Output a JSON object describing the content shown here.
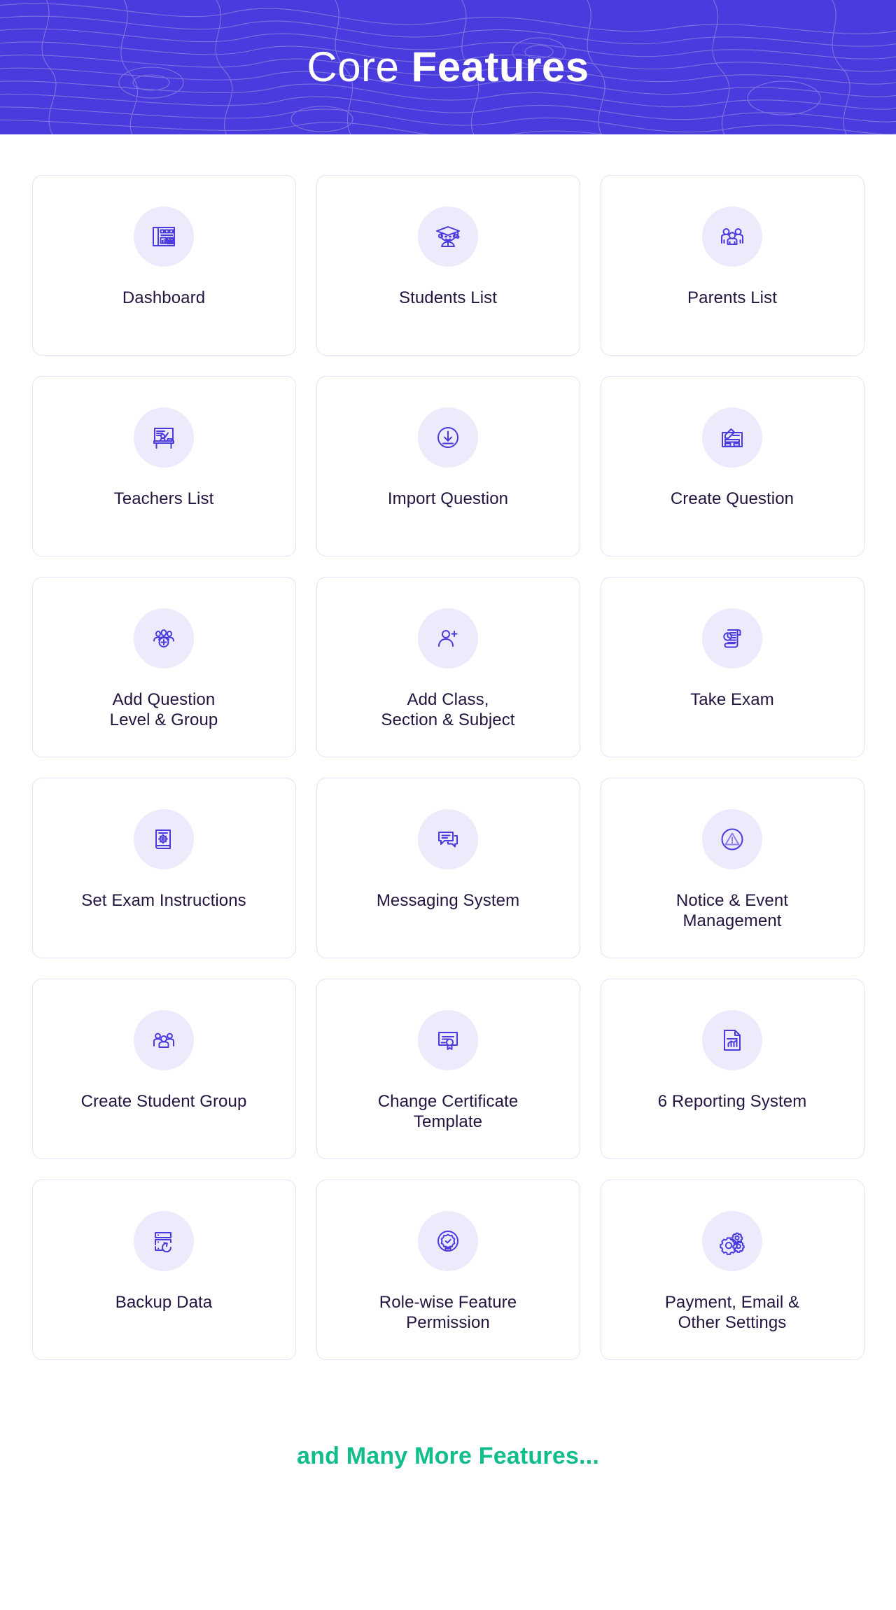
{
  "header": {
    "title_part1": "Core ",
    "title_part2": "Features",
    "background_color": "#4a3bdf",
    "pattern": "topographic-contour-lines"
  },
  "theme": {
    "accent_purple": "#4a3bdf",
    "icon_circle_bg": "#edeafc",
    "card_border": "#e3e1fa",
    "label_color": "#231440",
    "footer_accent": "#11bd8d"
  },
  "features": [
    {
      "label": "Dashboard",
      "icon": "dashboard-icon"
    },
    {
      "label": "Students List",
      "icon": "graduate-student-icon"
    },
    {
      "label": "Parents List",
      "icon": "family-group-icon"
    },
    {
      "label": "Teachers List",
      "icon": "teacher-whiteboard-icon"
    },
    {
      "label": "Import Question",
      "icon": "download-circle-icon"
    },
    {
      "label": "Create Question",
      "icon": "form-pencil-icon"
    },
    {
      "label": "Add Question\nLevel & Group",
      "icon": "group-add-icon"
    },
    {
      "label": "Add Class,\nSection & Subject",
      "icon": "person-add-icon"
    },
    {
      "label": "Take Exam",
      "icon": "exam-scroll-clock-icon"
    },
    {
      "label": "Set Exam Instructions",
      "icon": "book-gear-icon"
    },
    {
      "label": "Messaging System",
      "icon": "chat-bubbles-icon"
    },
    {
      "label": "Notice & Event\nManagement",
      "icon": "alert-triangle-circle-icon"
    },
    {
      "label": "Create Student Group",
      "icon": "people-group-icon"
    },
    {
      "label": "Change Certificate\nTemplate",
      "icon": "certificate-ribbon-icon"
    },
    {
      "label": "6 Reporting System",
      "icon": "report-chart-document-icon"
    },
    {
      "label": "Backup Data",
      "icon": "server-restore-icon"
    },
    {
      "label": "Role-wise Feature\nPermission",
      "icon": "badge-check-icon"
    },
    {
      "label": "Payment, Email &\nOther Settings",
      "icon": "gears-icon"
    }
  ],
  "footer": {
    "text": "and Many More Features..."
  }
}
